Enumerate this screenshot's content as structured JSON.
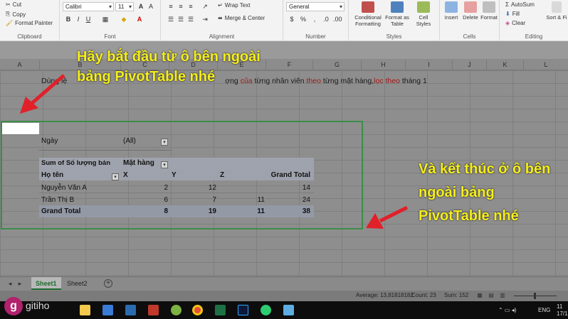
{
  "ribbon": {
    "clipboard": {
      "cut": "Cut",
      "copy": "Copy",
      "format_painter": "Format Painter",
      "label": "Clipboard"
    },
    "font": {
      "name": "Calibri",
      "size": "11",
      "label": "Font"
    },
    "alignment": {
      "wrap_text": "Wrap Text",
      "merge_center": "Merge & Center",
      "label": "Alignment"
    },
    "number": {
      "format": "General",
      "label": "Number"
    },
    "styles": {
      "conditional": "Conditional Formatting",
      "format_table": "Format as Table",
      "cell_styles": "Cell Styles",
      "label": "Styles"
    },
    "cells": {
      "insert": "Insert",
      "delete": "Delete",
      "format": "Format",
      "label": "Cells"
    },
    "editing": {
      "autosum": "AutoSum",
      "fill": "Fill",
      "clear": "Clear",
      "sort": "Sort & Fi",
      "label": "Editing"
    }
  },
  "columns": [
    "A",
    "B",
    "C",
    "D",
    "E",
    "F",
    "G",
    "H",
    "I",
    "J",
    "K",
    "L"
  ],
  "headline": {
    "p1": "Dùng lệ",
    "p2": "ợng ",
    "p3": "của",
    "p4": " từng nhân viên ",
    "p5": "theo",
    "p6": " từng mặt hàng,",
    "p7": "lọc theo",
    "p8": " tháng 1"
  },
  "pivot": {
    "filter_label": "Ngày",
    "filter_value": "(All)",
    "values_header": "Sum of Số lượng bán",
    "columns_header": "Mặt hàng",
    "rows_header": "Họ tên",
    "col_labels": [
      "X",
      "Y",
      "Z",
      "Grand Total"
    ],
    "rows": [
      {
        "name": "Nguyễn Văn A",
        "x": "2",
        "y": "12",
        "z": "",
        "total": "14"
      },
      {
        "name": "Trần Thị B",
        "x": "6",
        "y": "7",
        "z": "11",
        "total": "24"
      }
    ],
    "grand": {
      "name": "Grand Total",
      "x": "8",
      "y": "19",
      "z": "11",
      "total": "38"
    }
  },
  "annotations": {
    "top_line1": "Hãy bắt đầu từ ô bên ngoài",
    "top_line2": "bảng PivotTable nhé",
    "right_line1": "Và kết thúc ở ô bên",
    "right_line2": "ngoài bảng",
    "right_line3": "PivotTable nhé"
  },
  "sheets": [
    "Sheet1",
    "Sheet2"
  ],
  "status": {
    "average": "Average: 13,81818182",
    "count": "Count: 23",
    "sum": "Sum: 152"
  },
  "taskbar": {
    "brand": "gitiho",
    "lang": "ENG",
    "time": "11",
    "date": "17/1"
  },
  "colors": {
    "annotation": "#f5ee1c",
    "arrow": "#e0212a",
    "pivot_border": "#3c8c4a",
    "logo": "#b0226c"
  }
}
